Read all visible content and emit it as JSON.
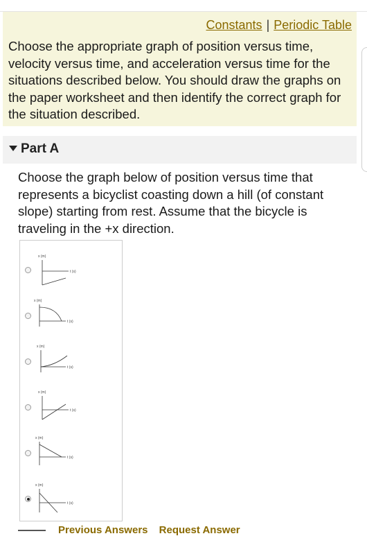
{
  "header": {
    "links": {
      "constants": "Constants",
      "separator": "|",
      "periodic_table": "Periodic Table"
    }
  },
  "intro": {
    "text": "Choose the appropriate graph of position versus time, velocity versus time, and acceleration versus time for the situations described below. You should draw the graphs on the paper worksheet and then identify the correct graph for the situation described."
  },
  "part": {
    "title": "Part A",
    "question": "Choose the graph below of position versus time that represents a bicyclist coasting down a hill (of constant slope) starting from rest. Assume that the bicycle is traveling in the +x direction."
  },
  "graph_options": [
    {
      "xlabel": "x (m)",
      "tlabel": "t (s)",
      "curve": "line-down",
      "selected": false
    },
    {
      "xlabel": "x (m)",
      "tlabel": "t (s)",
      "curve": "concave-down",
      "selected": false
    },
    {
      "xlabel": "x (m)",
      "tlabel": "t (s)",
      "curve": "concave-up",
      "selected": false
    },
    {
      "xlabel": "x (m)",
      "tlabel": "t (s)",
      "curve": "line-up",
      "selected": false
    },
    {
      "xlabel": "x (m)",
      "tlabel": "t (s)",
      "curve": "line-up-steep",
      "selected": false
    },
    {
      "xlabel": "x (m)",
      "tlabel": "t (s)",
      "curve": "line-down-steep",
      "selected": true
    }
  ],
  "footer": {
    "previous_answers": "Previous Answers",
    "request_answer": "Request Answer"
  },
  "colors": {
    "intro_bg": "#f6f5dc",
    "link": "#8a6a00",
    "part_bg": "#f2f2f2"
  }
}
